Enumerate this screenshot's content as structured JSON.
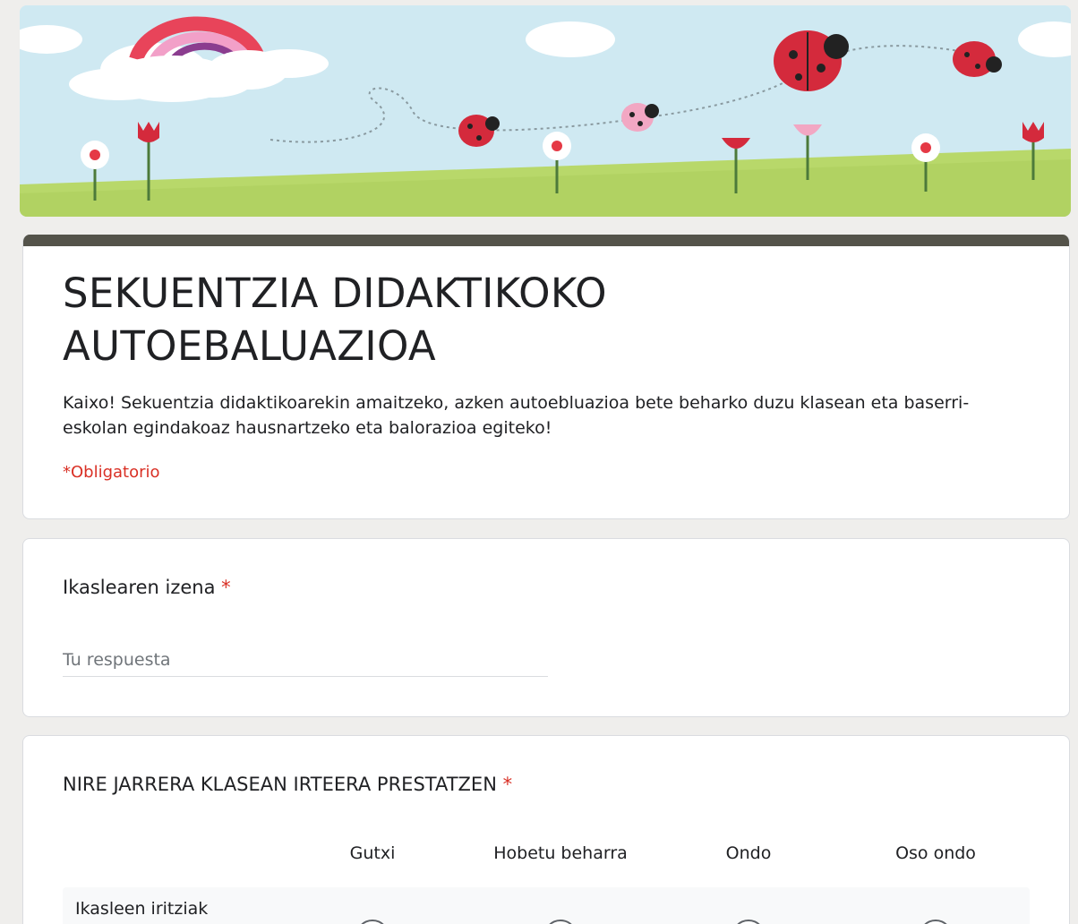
{
  "form": {
    "title": "SEKUENTZIA DIDAKTIKOKO AUTOEBALUAZIOA",
    "description": "Kaixo! Sekuentzia didaktikoarekin amaitzeko, azken autoebluazioa bete beharko duzu klasean eta baserri-eskolan egindakoaz hausnartzeko eta balorazioa egiteko!",
    "required_note": "*Obligatorio"
  },
  "questions": {
    "name": {
      "label": "Ikaslearen izena",
      "required_star": "*",
      "placeholder": "Tu respuesta"
    },
    "attitude": {
      "label": "NIRE JARRERA KLASEAN IRTEERA PRESTATZEN",
      "required_star": "*",
      "columns": [
        "Gutxi",
        "Hobetu beharra",
        "Ondo",
        "Oso ondo"
      ],
      "rows": [
        "Ikasleen iritziak"
      ]
    }
  },
  "colors": {
    "accent_bar": "#54534a",
    "required": "#d93025",
    "sky": "#cfe9f2",
    "grass": "#b8d86a"
  },
  "banner_icons": [
    "cloud-icon",
    "rainbow-icon",
    "ladybug-icon",
    "flower-icon",
    "tulip-icon"
  ]
}
